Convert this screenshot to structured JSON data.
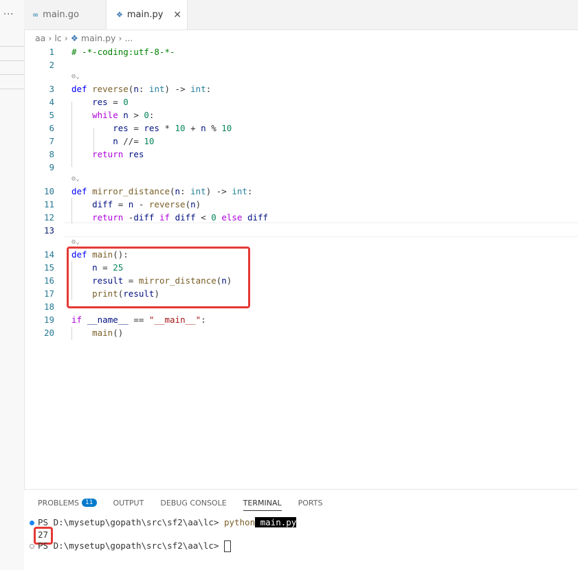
{
  "sidebar": {
    "more_label": "···"
  },
  "tabs": [
    {
      "label": "main.go",
      "icon": "go-icon"
    },
    {
      "label": "main.py",
      "icon": "python-icon",
      "close": "✕"
    }
  ],
  "breadcrumb": [
    "aa",
    "lc",
    "main.py",
    "..."
  ],
  "editor": {
    "line_numbers": [
      "1",
      "2",
      "3",
      "4",
      "5",
      "6",
      "7",
      "8",
      "9",
      "10",
      "11",
      "12",
      "13",
      "14",
      "15",
      "16",
      "17",
      "18",
      "19",
      "20"
    ]
  },
  "panel": {
    "tabs": [
      "PROBLEMS",
      "OUTPUT",
      "DEBUG CONSOLE",
      "TERMINAL",
      "PORTS"
    ],
    "problems_count": "11",
    "active_tab": "TERMINAL"
  },
  "terminal": {
    "prompt1": "PS D:\\mysetup\\gopath\\src\\sf2\\aa\\lc> ",
    "cmd": "python",
    "arg": " main.py",
    "output": "27",
    "prompt2": "PS D:\\mysetup\\gopath\\src\\sf2\\aa\\lc> "
  },
  "colors": {
    "accent": "#007acc",
    "highlight_box": "#e53935"
  }
}
